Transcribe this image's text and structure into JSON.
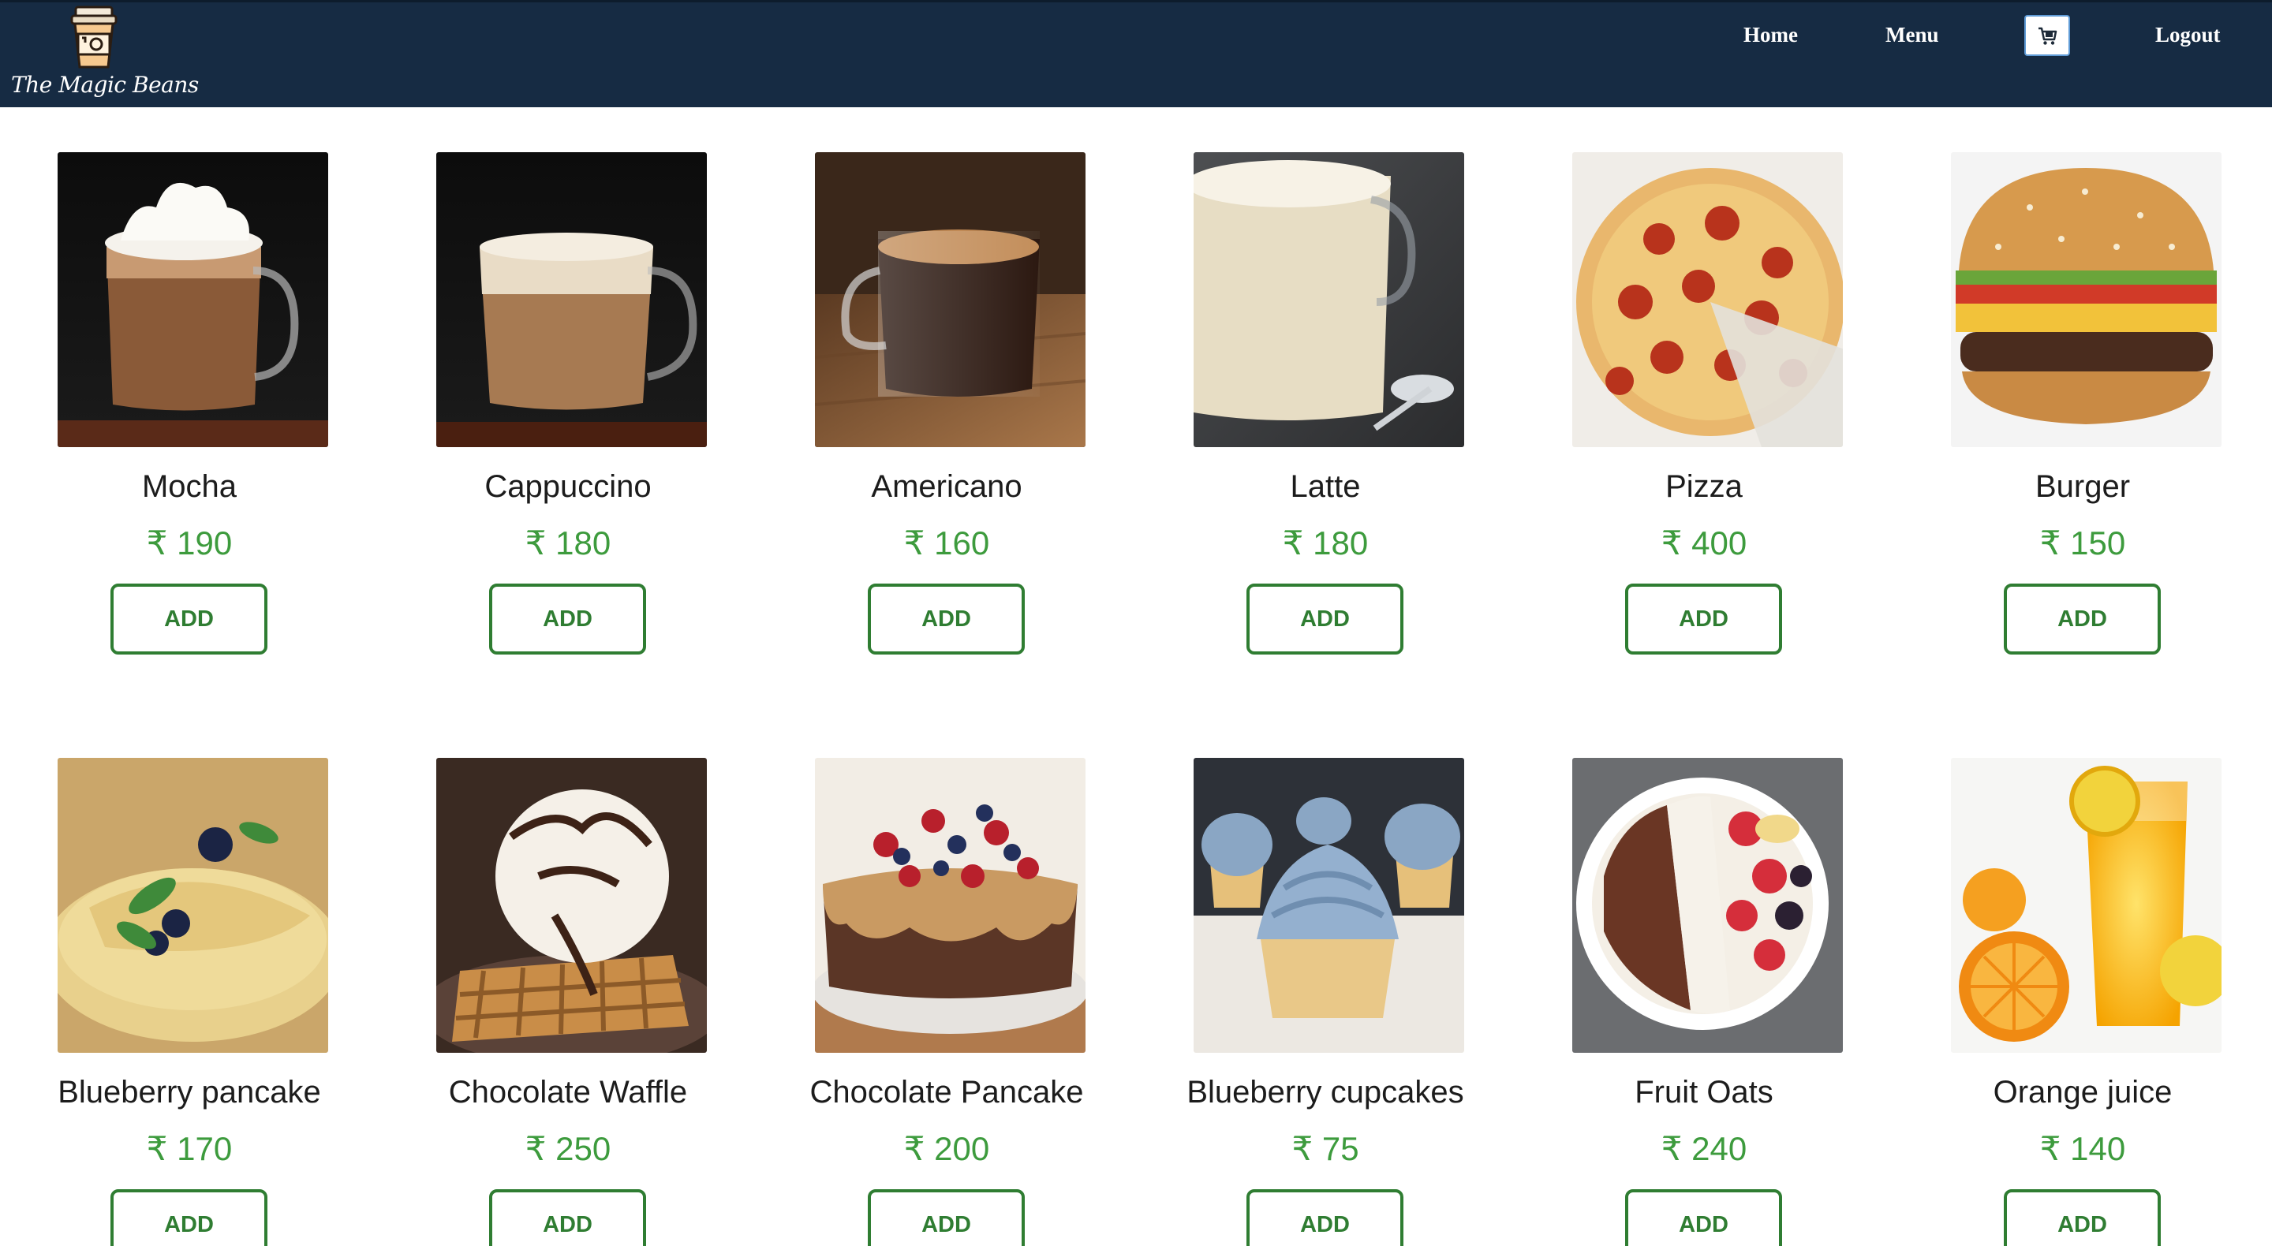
{
  "nav": {
    "brand_name": "The Magic Beans",
    "logo_icon": "coffee-cup-logo-icon",
    "links": {
      "home": "Home",
      "menu": "Menu",
      "logout": "Logout"
    },
    "cart_icon": "cart-icon",
    "colors": {
      "background": "#162b43",
      "text": "#ffffff"
    }
  },
  "currency_symbol": "₹",
  "add_button_label": "ADD",
  "colors": {
    "price": "#3d9b3d",
    "button": "#2f7d32"
  },
  "items": [
    {
      "name": "Mocha",
      "price": "190",
      "image": "mocha-photo"
    },
    {
      "name": "Cappuccino",
      "price": "180",
      "image": "cappuccino-photo"
    },
    {
      "name": "Americano",
      "price": "160",
      "image": "americano-photo"
    },
    {
      "name": "Latte",
      "price": "180",
      "image": "latte-photo"
    },
    {
      "name": "Pizza",
      "price": "400",
      "image": "pizza-photo"
    },
    {
      "name": "Burger",
      "price": "150",
      "image": "burger-photo"
    },
    {
      "name": "Blueberry pancake",
      "price": "170",
      "image": "blueberry-pancake-photo"
    },
    {
      "name": "Chocolate Waffle",
      "price": "250",
      "image": "chocolate-waffle-photo"
    },
    {
      "name": "Chocolate Pancake",
      "price": "200",
      "image": "chocolate-pancake-photo"
    },
    {
      "name": "Blueberry cupcakes",
      "price": "75",
      "image": "blueberry-cupcakes-photo"
    },
    {
      "name": "Fruit Oats",
      "price": "240",
      "image": "fruit-oats-photo"
    },
    {
      "name": "Orange juice",
      "price": "140",
      "image": "orange-juice-photo"
    }
  ]
}
